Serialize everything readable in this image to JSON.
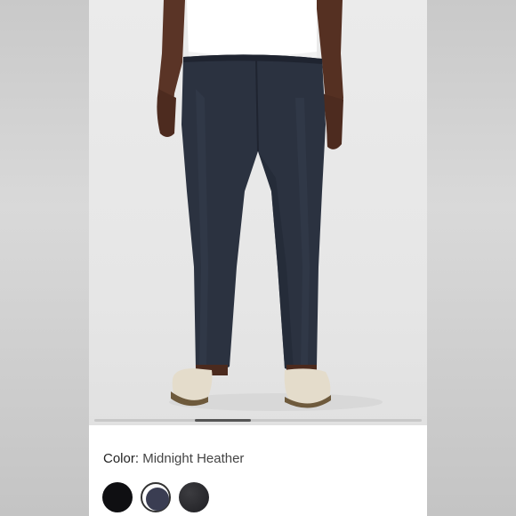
{
  "product": {
    "color_label": "Color",
    "color_value": "Midnight Heather"
  },
  "swatches": [
    {
      "name": "Black",
      "color": "#0f0f12",
      "selected": false
    },
    {
      "name": "Midnight Heather",
      "color": "#3a3d52",
      "selected": true
    },
    {
      "name": "Heathered Black",
      "color": "#2a2a2e",
      "selected": false
    }
  ],
  "gallery": {
    "scroll_position": 0.37
  },
  "colors": {
    "pants": "#2b3240",
    "shirt": "#ffffff",
    "skin": "#5a3426",
    "shoes": "#e4dccb",
    "background": "#e8e8e8"
  }
}
